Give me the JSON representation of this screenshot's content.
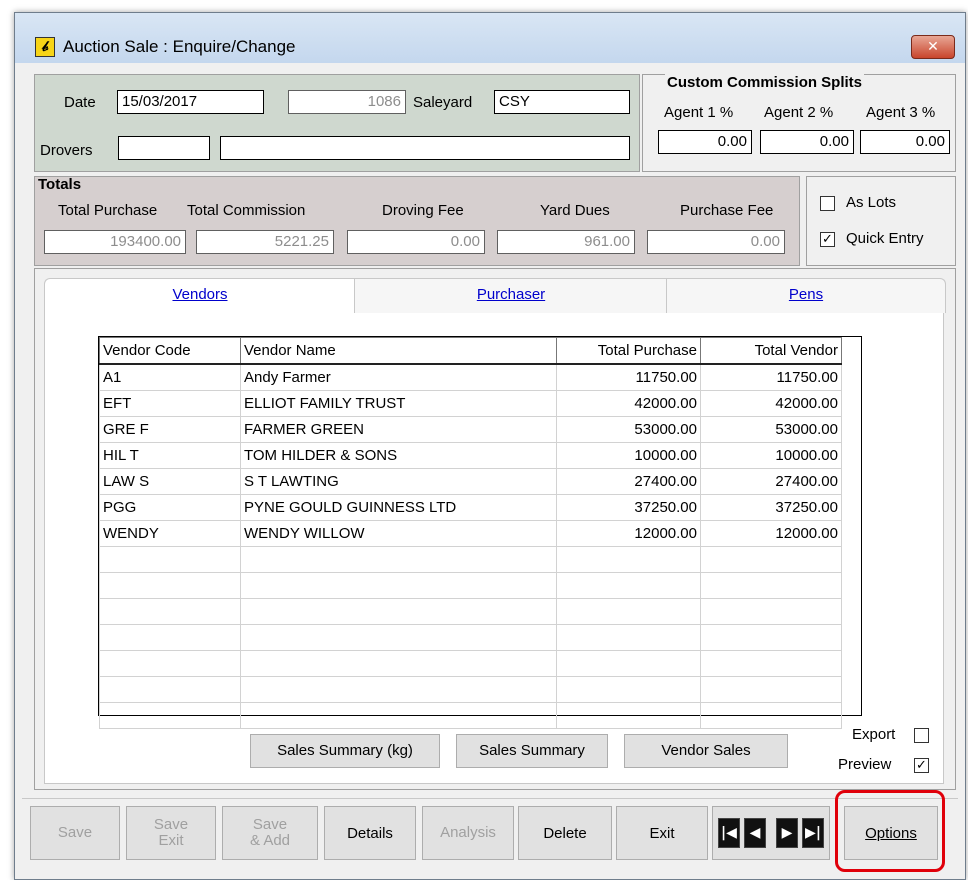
{
  "window": {
    "title": "Auction Sale : Enquire/Change",
    "close": "✕"
  },
  "header": {
    "date_label": "Date",
    "date": "15/03/2017",
    "sale_no": "1086",
    "saleyard_label": "Saleyard",
    "saleyard": "CSY",
    "drovers_label": "Drovers",
    "drovers_code": "",
    "drovers_name": ""
  },
  "commission": {
    "title": "Custom Commission Splits",
    "agent1_label": "Agent 1 %",
    "agent2_label": "Agent 2 %",
    "agent3_label": "Agent 3 %",
    "agent1": "0.00",
    "agent2": "0.00",
    "agent3": "0.00"
  },
  "totals": {
    "title": "Totals",
    "purchase_label": "Total Purchase",
    "commission_label": "Total Commission",
    "droving_label": "Droving Fee",
    "yard_label": "Yard Dues",
    "fee_label": "Purchase Fee",
    "purchase": "193400.00",
    "commission": "5221.25",
    "droving": "0.00",
    "yard": "961.00",
    "fee": "0.00"
  },
  "options": {
    "as_lots": "As Lots",
    "quick_entry": "Quick Entry",
    "check": "✓"
  },
  "tabs": [
    "Vendors",
    "Purchaser",
    "Pens"
  ],
  "grid": {
    "columns": [
      "Vendor Code",
      "Vendor Name",
      "Total Purchase",
      "Total Vendor"
    ],
    "rows": [
      [
        "A1",
        "Andy Farmer",
        "11750.00",
        "11750.00"
      ],
      [
        "EFT",
        "ELLIOT FAMILY TRUST",
        "42000.00",
        "42000.00"
      ],
      [
        "GRE F",
        "FARMER GREEN",
        "53000.00",
        "53000.00"
      ],
      [
        "HIL T",
        "TOM HILDER & SONS",
        "10000.00",
        "10000.00"
      ],
      [
        "LAW S",
        "S T LAWTING",
        "27400.00",
        "27400.00"
      ],
      [
        "PGG",
        "PYNE GOULD GUINNESS LTD",
        "37250.00",
        "37250.00"
      ],
      [
        "WENDY",
        "WENDY WILLOW",
        "12000.00",
        "12000.00"
      ]
    ],
    "empty_rows": 7
  },
  "reports": {
    "sales_summary_kg": "Sales Summary (kg)",
    "sales_summary": "Sales Summary",
    "vendor_sales": "Vendor Sales",
    "export": "Export",
    "preview": "Preview"
  },
  "buttons": {
    "save": "Save",
    "save_exit_1": "Save",
    "save_exit_2": "Exit",
    "save_add_1": "Save",
    "save_add_2": "& Add",
    "details": "Details",
    "analysis": "Analysis",
    "delete": "Delete",
    "exit": "Exit",
    "first": "|◀",
    "prev": "◀",
    "next": "▶",
    "last": "▶|",
    "options": "Options"
  }
}
